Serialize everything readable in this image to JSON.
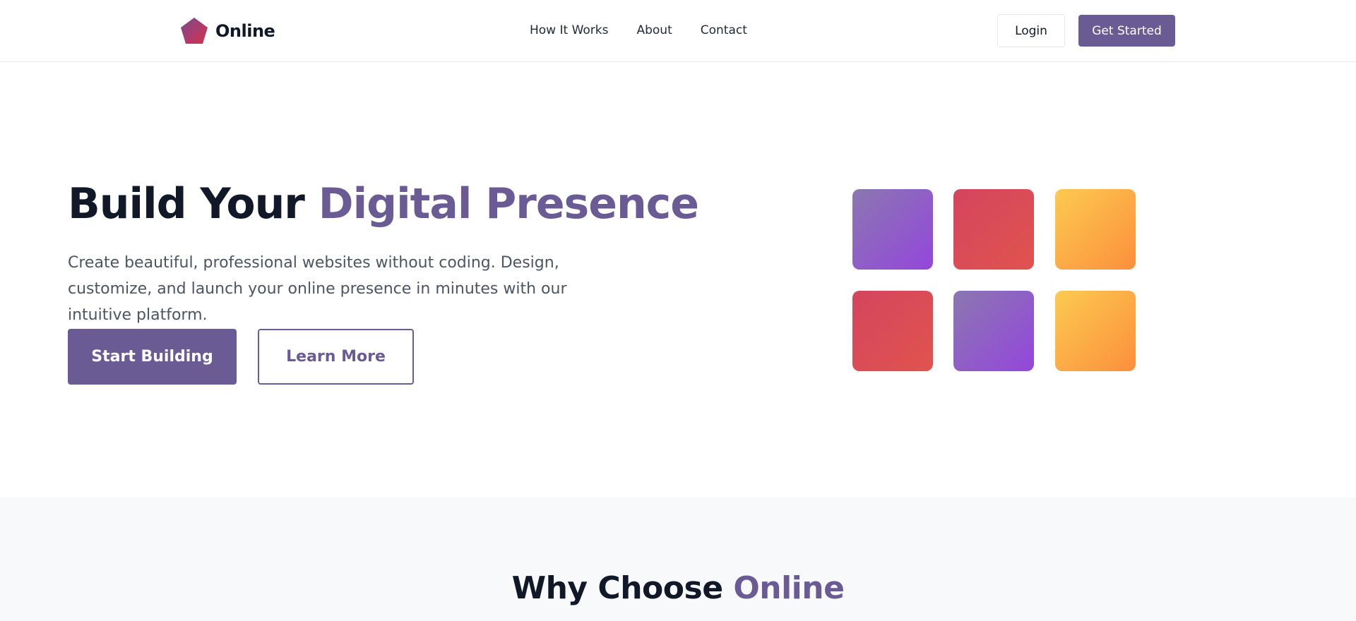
{
  "brand": {
    "name": "Online",
    "logo_icon": "pentagon-logo-icon",
    "logo_color_start": "#6b5b95",
    "logo_color_end": "#d6304f"
  },
  "nav": [
    {
      "label": "How It Works"
    },
    {
      "label": "About"
    },
    {
      "label": "Contact"
    }
  ],
  "header": {
    "login_label": "Login",
    "cta_label": "Get Started"
  },
  "hero": {
    "title_start": "Build Your ",
    "title_accent": "Digital Presence",
    "description": "Create beautiful, professional websites without coding. Design, customize, and launch your online presence in minutes with our intuitive platform.",
    "primary_button": "Start Building",
    "secondary_button": "Learn More"
  },
  "tiles": [
    "purple",
    "red",
    "orange",
    "red",
    "purple",
    "orange"
  ],
  "features": {
    "title_start": "Why Choose ",
    "title_accent": "Online"
  },
  "colors": {
    "accent": "#6b5b95",
    "text_dark": "#111827",
    "text_muted": "#4b5563"
  }
}
